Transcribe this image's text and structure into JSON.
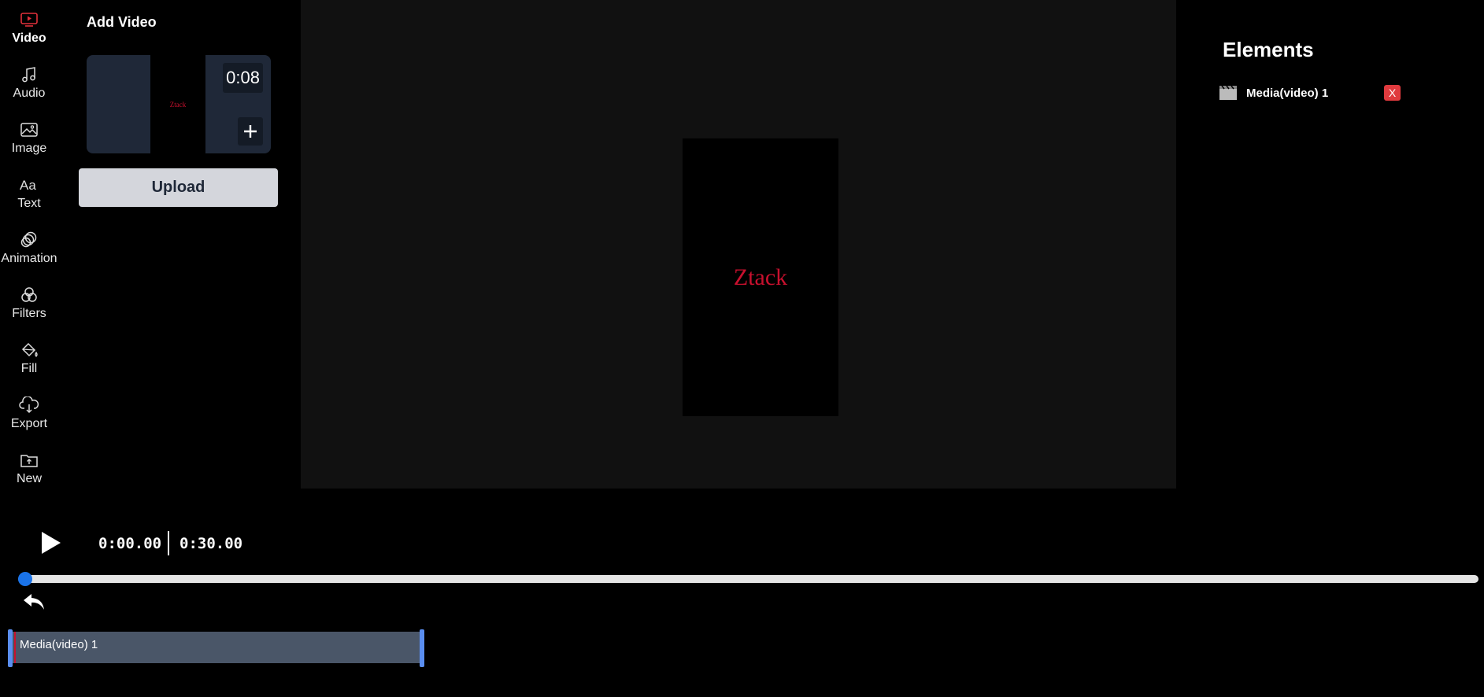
{
  "sidebar": {
    "items": [
      {
        "label": "Video",
        "icon": "video-icon",
        "active": true
      },
      {
        "label": "Audio",
        "icon": "music-note-icon"
      },
      {
        "label": "Image",
        "icon": "image-icon"
      },
      {
        "label": "Text",
        "icon": "text-icon"
      },
      {
        "label": "Animation",
        "icon": "animation-icon"
      },
      {
        "label": "Filters",
        "icon": "filters-icon"
      },
      {
        "label": "Fill",
        "icon": "paint-bucket-icon"
      },
      {
        "label": "Export",
        "icon": "cloud-download-icon"
      },
      {
        "label": "New",
        "icon": "new-folder-icon"
      }
    ]
  },
  "panel": {
    "title": "Add Video",
    "thumbnail": {
      "duration": "0:08",
      "preview_text": "Ztack"
    },
    "upload_label": "Upload"
  },
  "canvas": {
    "preview_text": "Ztack"
  },
  "elements": {
    "title": "Elements",
    "items": [
      {
        "name": "Media(video) 1",
        "delete_label": "X"
      }
    ]
  },
  "timeline": {
    "current_time": "0:00.00",
    "total_time": "0:30.00",
    "progress": 0.0,
    "clips": [
      {
        "label": "Media(video) 1"
      }
    ]
  },
  "colors": {
    "accent": "#c8102e",
    "brand_blue": "#1a73e8",
    "delete_red": "#e03a3e"
  }
}
